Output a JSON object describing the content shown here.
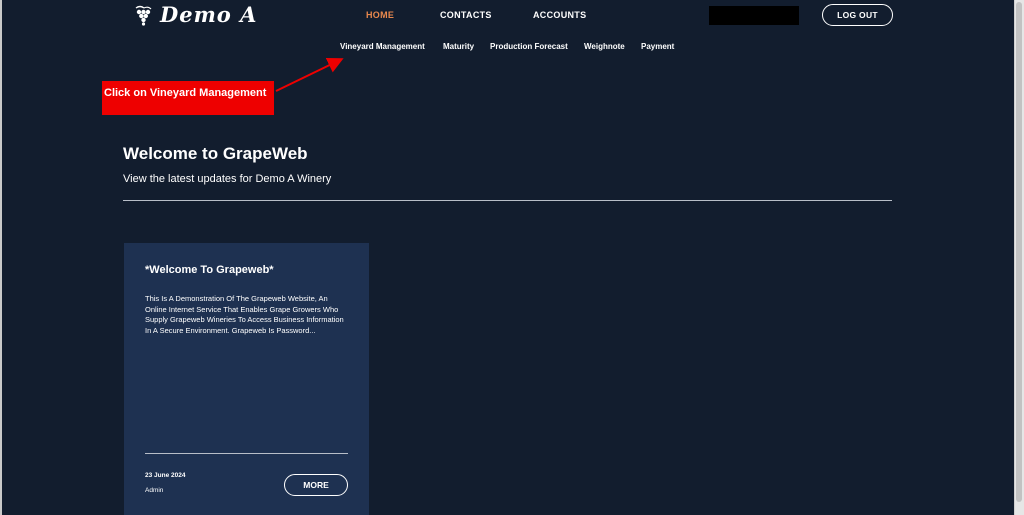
{
  "brand": {
    "name": "Demo A",
    "logo_icon": "grape-cluster-icon"
  },
  "topnav": [
    {
      "label": "HOME",
      "active": true
    },
    {
      "label": "CONTACTS",
      "active": false
    },
    {
      "label": "ACCOUNTS",
      "active": false
    }
  ],
  "header": {
    "logout_label": "LOG OUT"
  },
  "subnav": [
    {
      "label": "Vineyard Management"
    },
    {
      "label": "Maturity"
    },
    {
      "label": "Production Forecast"
    },
    {
      "label": "Weighnote"
    },
    {
      "label": "Payment"
    }
  ],
  "annotation": {
    "text": "Click on Vineyard Management",
    "color": "#ee0000"
  },
  "welcome": {
    "title": "Welcome to GrapeWeb",
    "subtitle": "View the latest updates for Demo A Winery"
  },
  "card": {
    "title": "*Welcome To Grapeweb*",
    "body": "This Is A Demonstration Of The Grapeweb Website, An Online Internet Service That Enables Grape Growers Who Supply Grapeweb Wineries To Access Business Information In A Secure Environment. Grapeweb Is Password...",
    "date": "23 June 2024",
    "author": "Admin",
    "more_label": "MORE"
  },
  "colors": {
    "background": "#121d2e",
    "card": "#1e3151",
    "accent": "#e8884d"
  }
}
